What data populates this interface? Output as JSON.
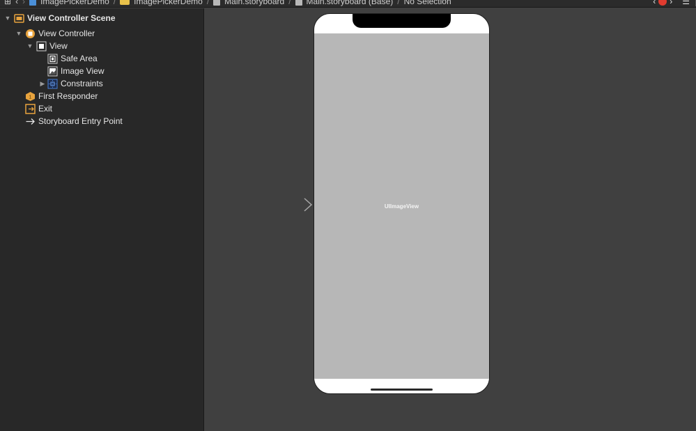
{
  "jumpbar": {
    "crumbs": [
      "ImagePickerDemo",
      "ImagePickerDemo",
      "Main.storyboard",
      "Main.storyboard (Base)",
      "No Selection"
    ]
  },
  "outline": {
    "items": [
      {
        "label": "View Controller Scene",
        "icon": "scene-icon"
      },
      {
        "label": "View Controller",
        "icon": "view-controller-icon"
      },
      {
        "label": "View",
        "icon": "view-icon"
      },
      {
        "label": "Safe Area",
        "icon": "safe-area-icon"
      },
      {
        "label": "Image View",
        "icon": "image-view-icon"
      },
      {
        "label": "Constraints",
        "icon": "constraints-icon"
      },
      {
        "label": "First Responder",
        "icon": "first-responder-icon"
      },
      {
        "label": "Exit",
        "icon": "exit-icon"
      },
      {
        "label": "Storyboard Entry Point",
        "icon": "arrow-right-icon"
      }
    ]
  },
  "canvas": {
    "image_view_label": "UIImageView"
  },
  "colors": {
    "accent": "#e8a33d",
    "image_view_fill": "#b7b7b7",
    "canvas_bg": "#404040",
    "sidebar_bg": "#282828"
  }
}
